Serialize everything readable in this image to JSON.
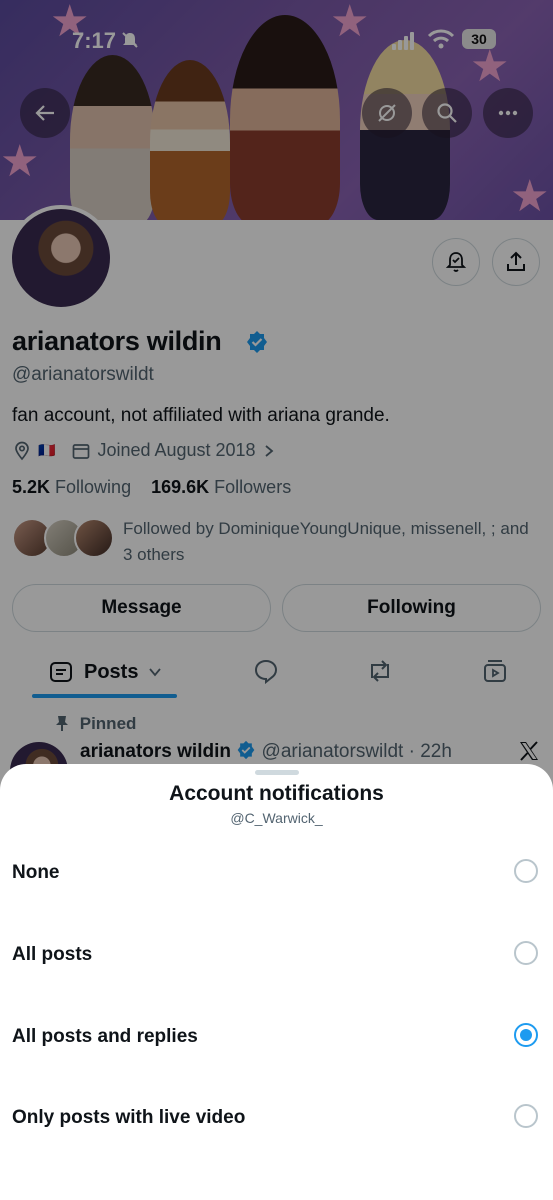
{
  "status_bar": {
    "time": "7:17",
    "battery": "30"
  },
  "profile": {
    "display_name": "arianators wildin",
    "handle": "@arianatorswildt",
    "bio": "fan account, not affiliated with ariana grande.",
    "location_flag": "🇫🇷",
    "joined": "Joined August 2018",
    "following_count": "5.2K",
    "following_label": "Following",
    "followers_count": "169.6K",
    "followers_label": "Followers",
    "followed_by_text": "Followed by DominiqueYoungUnique, missenell, ; and 3 others"
  },
  "buttons": {
    "message": "Message",
    "following": "Following"
  },
  "tabs": {
    "posts": "Posts"
  },
  "pinned_tweet": {
    "pinned_label": "Pinned",
    "name": "arianators wildin",
    "handle_time": "@arianatorswildt · 22h"
  },
  "sheet": {
    "title": "Account notifications",
    "subtitle": "@C_Warwick_",
    "options": [
      {
        "label": "None",
        "selected": false
      },
      {
        "label": "All posts",
        "selected": false
      },
      {
        "label": "All posts and replies",
        "selected": true
      },
      {
        "label": "Only posts with live video",
        "selected": false
      }
    ]
  },
  "colors": {
    "accent": "#1d9bf0",
    "text": "#0f1419",
    "muted": "#536471"
  },
  "icons": [
    "back-arrow-icon",
    "refresh-icon",
    "search-icon",
    "more-icon",
    "bell-check-icon",
    "share-icon",
    "location-icon",
    "calendar-icon",
    "chevron-right-icon",
    "list-icon",
    "chevron-down-icon",
    "reply-icon",
    "repost-icon",
    "media-icon",
    "pin-icon",
    "x-logo-icon",
    "verified-icon"
  ]
}
